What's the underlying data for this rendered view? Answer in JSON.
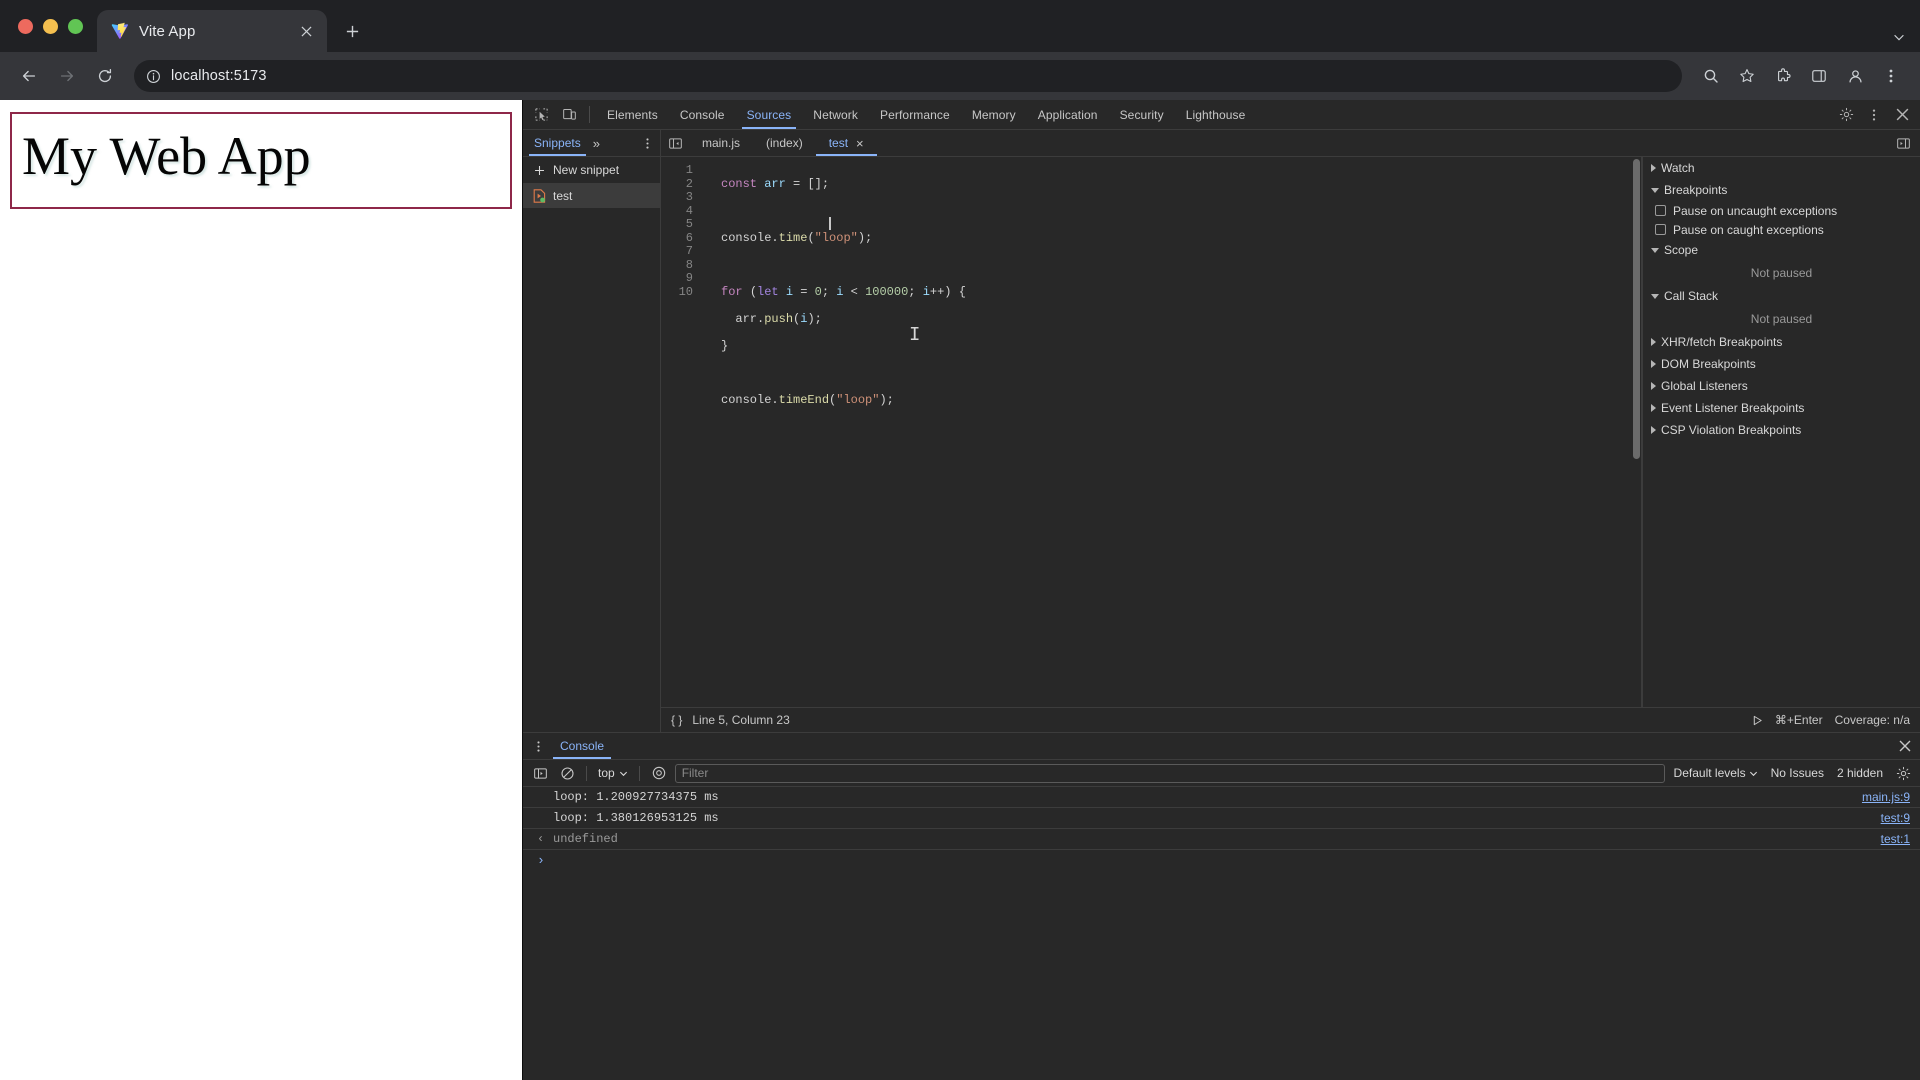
{
  "browser": {
    "tab": {
      "title": "Vite App",
      "favicon": "vite-logo-icon",
      "close": "×"
    },
    "new_tab_label": "+",
    "address": "localhost:5173",
    "reload_label": "⟳",
    "back_label": "←",
    "forward_label": "→"
  },
  "page": {
    "heading": "My Web App",
    "border_color": "#8e2749"
  },
  "devtools": {
    "panels": [
      {
        "label": "Elements",
        "active": false
      },
      {
        "label": "Console",
        "active": false
      },
      {
        "label": "Sources",
        "active": true
      },
      {
        "label": "Network",
        "active": false
      },
      {
        "label": "Performance",
        "active": false
      },
      {
        "label": "Memory",
        "active": false
      },
      {
        "label": "Application",
        "active": false
      },
      {
        "label": "Security",
        "active": false
      },
      {
        "label": "Lighthouse",
        "active": false
      }
    ],
    "accent_color": "#8ab4f8",
    "navigator": {
      "tab_label": "Snippets",
      "more_label": "»",
      "new_snippet_label": "New snippet",
      "items": [
        {
          "label": "test",
          "selected": true
        }
      ]
    },
    "file_tabs": [
      {
        "label": "main.js",
        "active": false,
        "closable": false
      },
      {
        "label": "(index)",
        "active": false,
        "closable": false
      },
      {
        "label": "test",
        "active": true,
        "closable": true,
        "close": "×"
      }
    ],
    "editor": {
      "line_numbers": [
        1,
        2,
        3,
        4,
        5,
        6,
        7,
        8,
        9,
        10
      ],
      "code_lines": [
        "const arr = [];",
        "",
        "console.time(\"loop\");",
        "",
        "for (let i = 0; i < 100000; i++) {",
        "  arr.push(i);",
        "}",
        "",
        "console.timeEnd(\"loop\");",
        ""
      ],
      "status_position": "Line 5, Column 23",
      "run_shortcut": "⌘+Enter",
      "coverage": "Coverage: n/a",
      "format_icon": "{ }"
    },
    "debugger": {
      "sections": [
        {
          "label": "Watch",
          "expanded": false
        },
        {
          "label": "Breakpoints",
          "expanded": true
        },
        {
          "label": "Scope",
          "expanded": true
        },
        {
          "label": "Call Stack",
          "expanded": true
        },
        {
          "label": "XHR/fetch Breakpoints",
          "expanded": false
        },
        {
          "label": "DOM Breakpoints",
          "expanded": false
        },
        {
          "label": "Global Listeners",
          "expanded": false
        },
        {
          "label": "Event Listener Breakpoints",
          "expanded": false
        },
        {
          "label": "CSP Violation Breakpoints",
          "expanded": false
        }
      ],
      "pause_uncaught": "Pause on uncaught exceptions",
      "pause_caught": "Pause on caught exceptions",
      "scope_status": "Not paused",
      "callstack_status": "Not paused"
    },
    "drawer": {
      "tab_label": "Console",
      "close_label": "×",
      "context": "top",
      "filter_placeholder": "Filter",
      "levels_label": "Default levels",
      "issues_label": "No Issues",
      "hidden_label": "2 hidden",
      "messages": [
        {
          "arrow": "",
          "text": "loop: 1.200927734375 ms",
          "link": "main.js:9",
          "dim": false
        },
        {
          "arrow": "",
          "text": "loop: 1.380126953125 ms",
          "link": "test:9",
          "dim": false
        },
        {
          "arrow": "‹",
          "text": "undefined",
          "link": "test:1",
          "dim": true
        }
      ],
      "prompt": "›"
    }
  }
}
